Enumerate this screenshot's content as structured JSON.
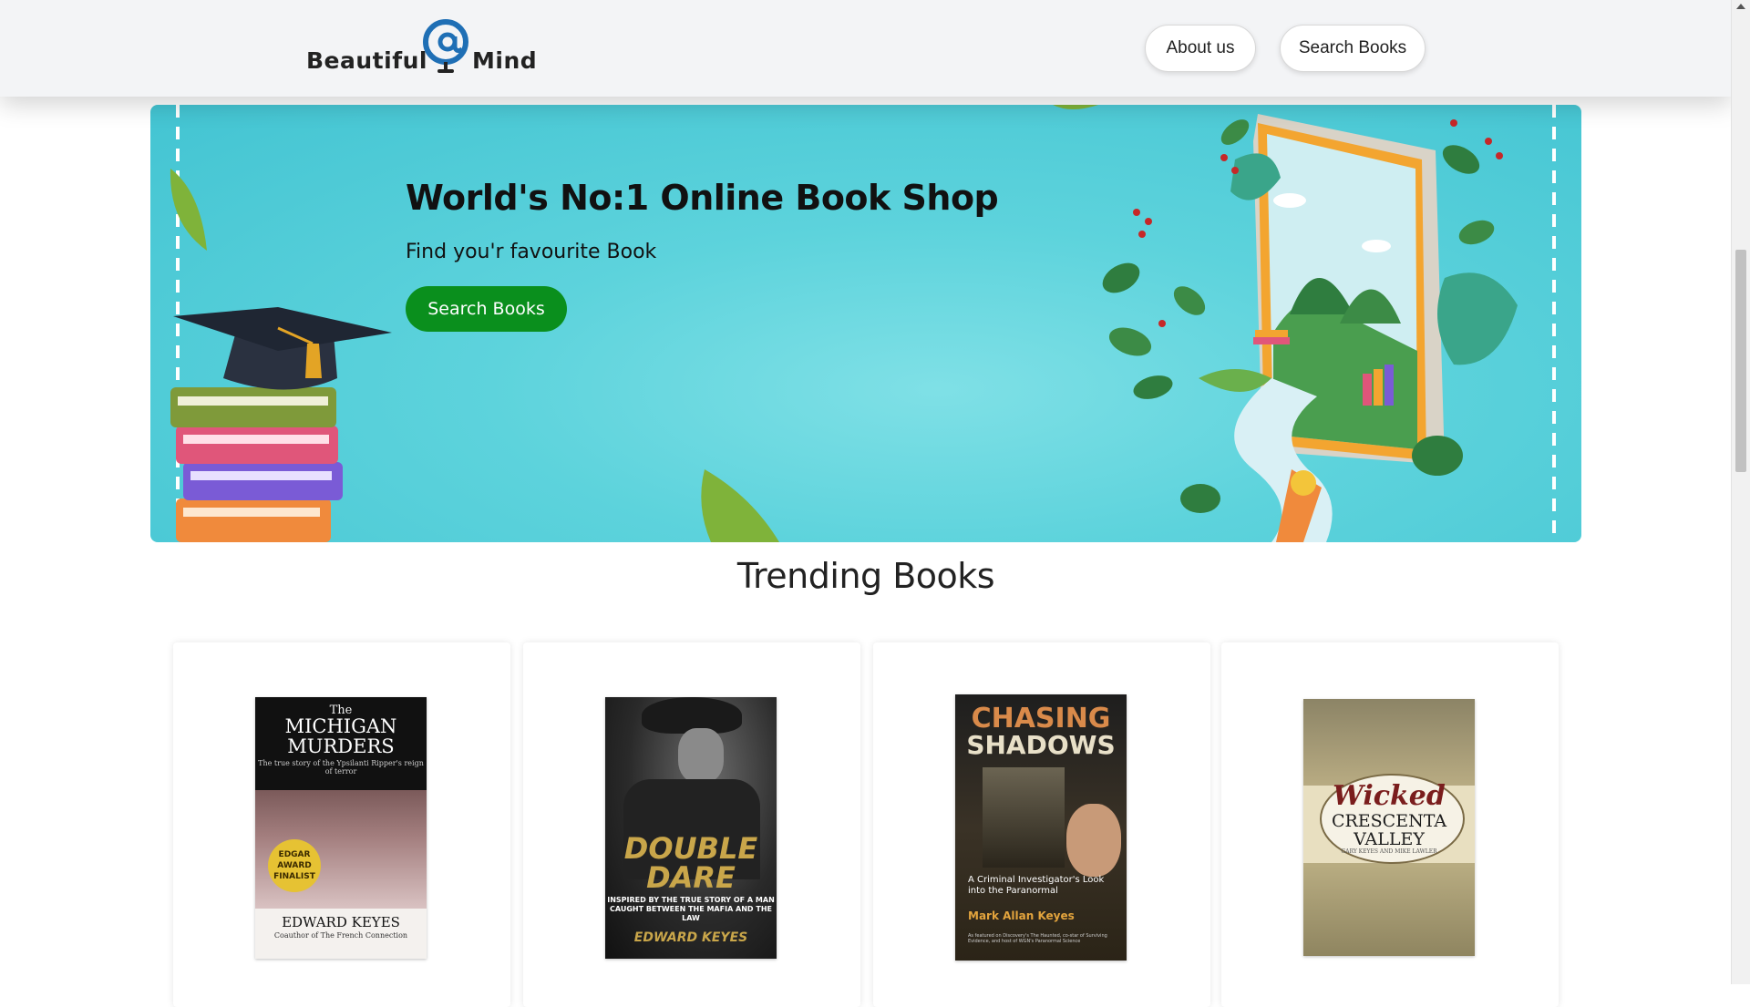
{
  "navbar": {
    "logo_text_1": "Beautiful",
    "logo_text_2": "Mind",
    "about_label": "About us",
    "search_label": "Search Books"
  },
  "hero": {
    "title": "World's No:1 Online Book Shop",
    "subtitle": "Find you'r favourite Book",
    "button_label": "Search Books"
  },
  "trending": {
    "title": "Trending Books",
    "books": [
      {
        "cover_lines": [
          "The",
          "MICHIGAN MURDERS",
          "The true story of the Ypsilanti Ripper's reign of terror",
          "EDGAR AWARD FINALIST",
          "EDWARD KEYES",
          "Coauthor of The French Connection"
        ]
      },
      {
        "cover_lines": [
          "DOUBLE DARE",
          "INSPIRED BY THE TRUE STORY OF A MAN CAUGHT BETWEEN THE MAFIA AND THE LAW",
          "EDWARD KEYES"
        ]
      },
      {
        "cover_lines": [
          "CHASING",
          "SHADOWS",
          "A Criminal Investigator's Look into the Paranormal",
          "Mark Allan Keyes",
          "As featured on Discovery's The Haunted, co-star of Surviving Evidence, and host of WGN's Paranormal Science"
        ]
      },
      {
        "cover_lines": [
          "Wicked",
          "CRESCENTA VALLEY",
          "GARY KEYES AND MIKE LAWLER"
        ]
      }
    ]
  },
  "colors": {
    "accent_green": "#0a8f1d",
    "hero_bg": "#5dd3dc",
    "navbar_bg": "#f3f4f6",
    "logo_blue": "#1f6fb5"
  }
}
